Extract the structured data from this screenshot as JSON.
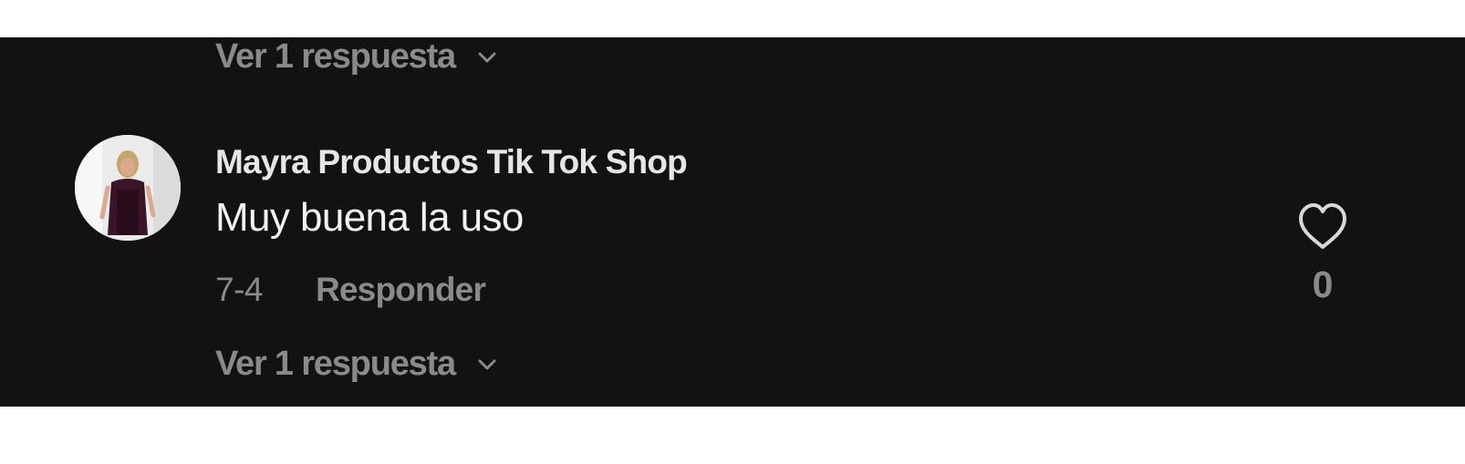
{
  "thread": {
    "view_replies_top": "Ver 1 respuesta",
    "view_replies_bottom": "Ver 1 respuesta"
  },
  "comment": {
    "author": "Mayra Productos Tik Tok Shop",
    "text": "Muy buena la uso",
    "date": "7-4",
    "reply_label": "Responder",
    "like_count": "0",
    "like_icon": "heart-icon",
    "avatar": "user-avatar"
  },
  "colors": {
    "background": "#121212",
    "primary_text": "#f2f2f2",
    "secondary_text": "#8a8a8a"
  }
}
